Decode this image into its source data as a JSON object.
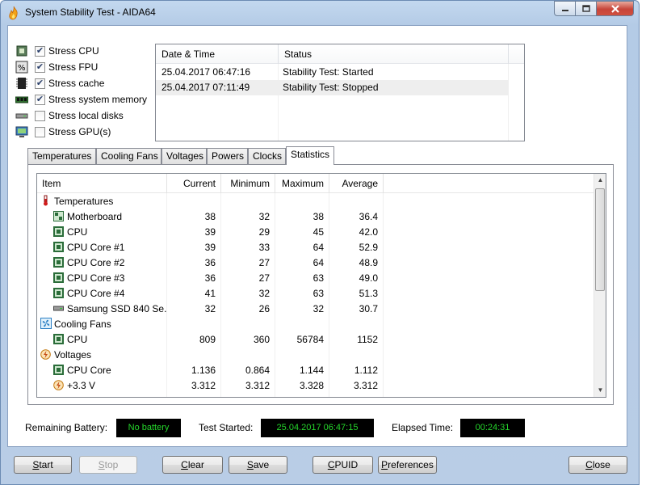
{
  "window": {
    "title": "System Stability Test - AIDA64",
    "min_icon": "minimize-icon",
    "max_icon": "maximize-icon",
    "close_icon": "close-icon"
  },
  "stress": [
    {
      "label": "Stress CPU",
      "checked": true,
      "icon": "cpu-icon"
    },
    {
      "label": "Stress FPU",
      "checked": true,
      "icon": "fpu-icon"
    },
    {
      "label": "Stress cache",
      "checked": true,
      "icon": "cache-icon"
    },
    {
      "label": "Stress system memory",
      "checked": true,
      "icon": "memory-icon"
    },
    {
      "label": "Stress local disks",
      "checked": false,
      "icon": "disk-icon"
    },
    {
      "label": "Stress GPU(s)",
      "checked": false,
      "icon": "monitor-icon"
    }
  ],
  "log": {
    "headers": [
      "Date & Time",
      "Status"
    ],
    "rows": [
      {
        "datetime": "25.04.2017 06:47:16",
        "status": "Stability Test: Started"
      },
      {
        "datetime": "25.04.2017 07:11:49",
        "status": "Stability Test: Stopped"
      }
    ]
  },
  "tabs": [
    "Temperatures",
    "Cooling Fans",
    "Voltages",
    "Powers",
    "Clocks",
    "Statistics"
  ],
  "active_tab": "Statistics",
  "stats": {
    "headers": [
      "Item",
      "Current",
      "Minimum",
      "Maximum",
      "Average"
    ],
    "rows": [
      {
        "type": "group",
        "icon": "thermometer-icon",
        "item": "Temperatures"
      },
      {
        "type": "item",
        "icon": "motherboard-icon",
        "item": "Motherboard",
        "current": "38",
        "minimum": "32",
        "maximum": "38",
        "average": "36.4"
      },
      {
        "type": "item",
        "icon": "chip-icon",
        "item": "CPU",
        "current": "39",
        "minimum": "29",
        "maximum": "45",
        "average": "42.0"
      },
      {
        "type": "item",
        "icon": "chip-icon",
        "item": "CPU Core #1",
        "current": "39",
        "minimum": "33",
        "maximum": "64",
        "average": "52.9"
      },
      {
        "type": "item",
        "icon": "chip-icon",
        "item": "CPU Core #2",
        "current": "36",
        "minimum": "27",
        "maximum": "64",
        "average": "48.9"
      },
      {
        "type": "item",
        "icon": "chip-icon",
        "item": "CPU Core #3",
        "current": "36",
        "minimum": "27",
        "maximum": "63",
        "average": "49.0"
      },
      {
        "type": "item",
        "icon": "chip-icon",
        "item": "CPU Core #4",
        "current": "41",
        "minimum": "32",
        "maximum": "63",
        "average": "51.3"
      },
      {
        "type": "item",
        "icon": "ssd-icon",
        "item": "Samsung SSD 840 Se...",
        "current": "32",
        "minimum": "26",
        "maximum": "32",
        "average": "30.7"
      },
      {
        "type": "group",
        "icon": "fan-icon",
        "item": "Cooling Fans"
      },
      {
        "type": "item",
        "icon": "chip-icon",
        "item": "CPU",
        "current": "809",
        "minimum": "360",
        "maximum": "56784",
        "average": "1152"
      },
      {
        "type": "group",
        "icon": "voltage-icon",
        "item": "Voltages"
      },
      {
        "type": "item",
        "icon": "chip-icon",
        "item": "CPU Core",
        "current": "1.136",
        "minimum": "0.864",
        "maximum": "1.144",
        "average": "1.112"
      },
      {
        "type": "item",
        "icon": "voltage-icon",
        "item": "+3.3 V",
        "current": "3.312",
        "minimum": "3.312",
        "maximum": "3.328",
        "average": "3.312"
      }
    ]
  },
  "status": {
    "battery_label": "Remaining Battery:",
    "battery_value": "No battery",
    "started_label": "Test Started:",
    "started_value": "25.04.2017 06:47:15",
    "elapsed_label": "Elapsed Time:",
    "elapsed_value": "00:24:31"
  },
  "buttons": {
    "start": {
      "first": "S",
      "rest": "tart"
    },
    "stop": {
      "first": "S",
      "rest": "top"
    },
    "clear": {
      "first": "C",
      "rest": "lear"
    },
    "save": {
      "first": "S",
      "rest": "ave"
    },
    "cpuid": {
      "first": "C",
      "rest": "PUID"
    },
    "preferences": {
      "first": "P",
      "rest": "references"
    },
    "close": {
      "first": "C",
      "rest": "lose"
    }
  },
  "colors": {
    "lcd_text": "#25d62b",
    "lcd_bg": "#000000",
    "title_gradient_top": "#c3d8ef",
    "close_red": "#c7453a"
  }
}
